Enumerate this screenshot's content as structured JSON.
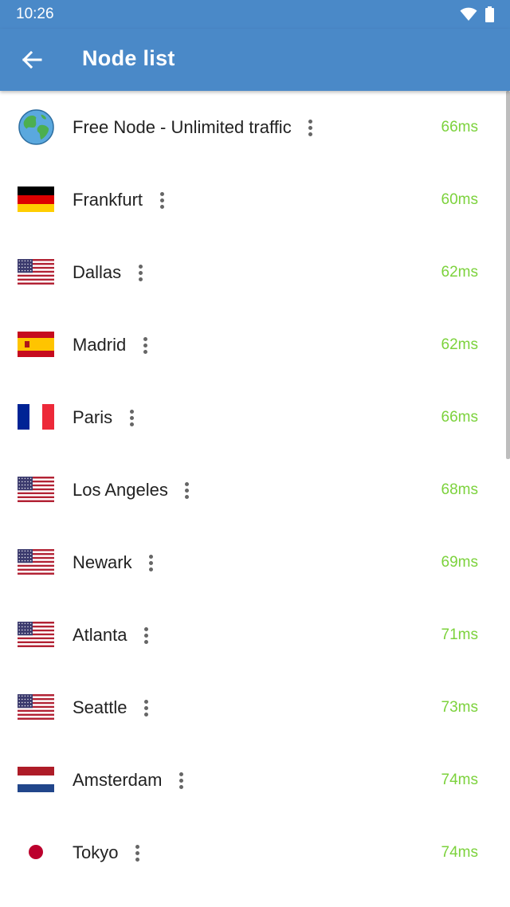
{
  "status_bar": {
    "time": "10:26",
    "icons": [
      "wifi-icon",
      "battery-icon"
    ]
  },
  "app_bar": {
    "title": "Node list",
    "back_icon": "arrow-left-icon"
  },
  "colors": {
    "primary": "#4a89c8",
    "latency": "#7cd23c"
  },
  "nodes": [
    {
      "name": "Free Node - Unlimited traffic",
      "latency": "66ms",
      "flag": "globe"
    },
    {
      "name": "Frankfurt",
      "latency": "60ms",
      "flag": "de"
    },
    {
      "name": "Dallas",
      "latency": "62ms",
      "flag": "us"
    },
    {
      "name": "Madrid",
      "latency": "62ms",
      "flag": "es"
    },
    {
      "name": "Paris",
      "latency": "66ms",
      "flag": "fr"
    },
    {
      "name": "Los Angeles",
      "latency": "68ms",
      "flag": "us"
    },
    {
      "name": "Newark",
      "latency": "69ms",
      "flag": "us"
    },
    {
      "name": "Atlanta",
      "latency": "71ms",
      "flag": "us"
    },
    {
      "name": "Seattle",
      "latency": "73ms",
      "flag": "us"
    },
    {
      "name": "Amsterdam",
      "latency": "74ms",
      "flag": "nl"
    },
    {
      "name": "Tokyo",
      "latency": "74ms",
      "flag": "jp"
    }
  ]
}
